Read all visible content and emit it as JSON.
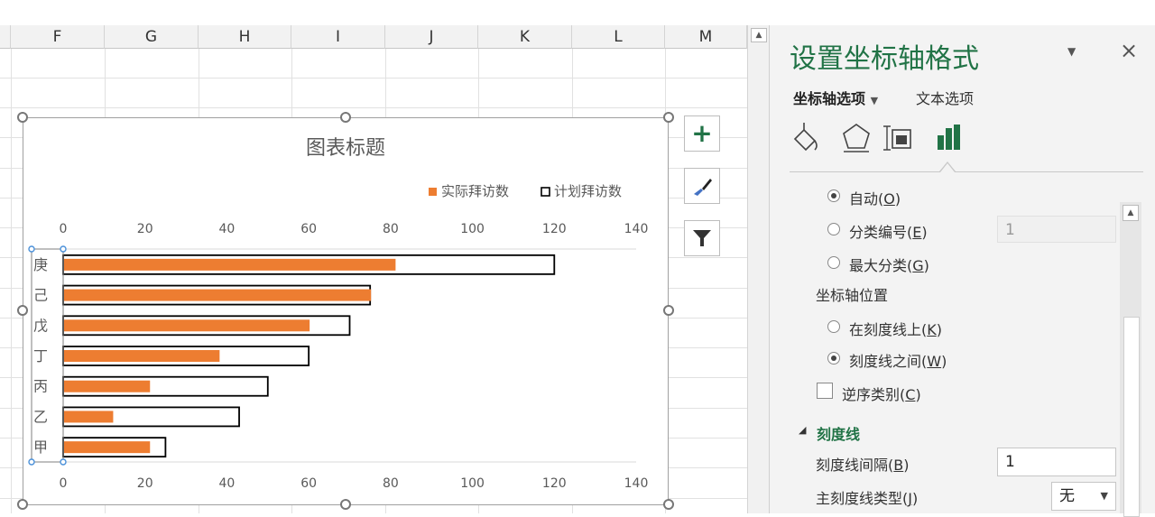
{
  "sheet": {
    "columns": [
      "F",
      "G",
      "H",
      "I",
      "J",
      "K",
      "L",
      "M"
    ]
  },
  "chart": {
    "title": "图表标题",
    "legend": [
      "实际拜访数",
      "计划拜访数"
    ]
  },
  "chart_data": {
    "type": "bar",
    "orientation": "horizontal",
    "categories": [
      "庚",
      "己",
      "戊",
      "丁",
      "丙",
      "乙",
      "甲"
    ],
    "series": [
      {
        "name": "实际拜访数",
        "values": [
          81,
          75,
          60,
          38,
          21,
          12,
          21
        ],
        "color": "#ed7d31"
      },
      {
        "name": "计划拜访数",
        "values": [
          120,
          75,
          70,
          60,
          50,
          43,
          25
        ],
        "color": "#000000"
      }
    ],
    "title": "图表标题",
    "xlim": [
      0,
      140
    ],
    "ticks": [
      "0",
      "20",
      "40",
      "60",
      "80",
      "100",
      "120",
      "140"
    ],
    "grid": false,
    "legend_position": "top-right"
  },
  "panel": {
    "title": "设置坐标轴格式",
    "tab_axis": "坐标轴选项",
    "tab_text": "文本选项",
    "opt_auto": "自动",
    "opt_auto_key": "O",
    "opt_cat": "分类编号",
    "opt_cat_key": "E",
    "opt_cat_value": "1",
    "opt_max": "最大分类",
    "opt_max_key": "G",
    "axis_pos": "坐标轴位置",
    "opt_on": "在刻度线上",
    "opt_on_key": "K",
    "opt_between": "刻度线之间",
    "opt_between_key": "W",
    "reverse": "逆序类别",
    "reverse_key": "C",
    "tick_section": "刻度线",
    "tick_interval": "刻度线间隔",
    "tick_interval_key": "B",
    "tick_interval_value": "1",
    "major_type": "主刻度线类型",
    "major_type_key": "J",
    "major_type_value": "无"
  }
}
